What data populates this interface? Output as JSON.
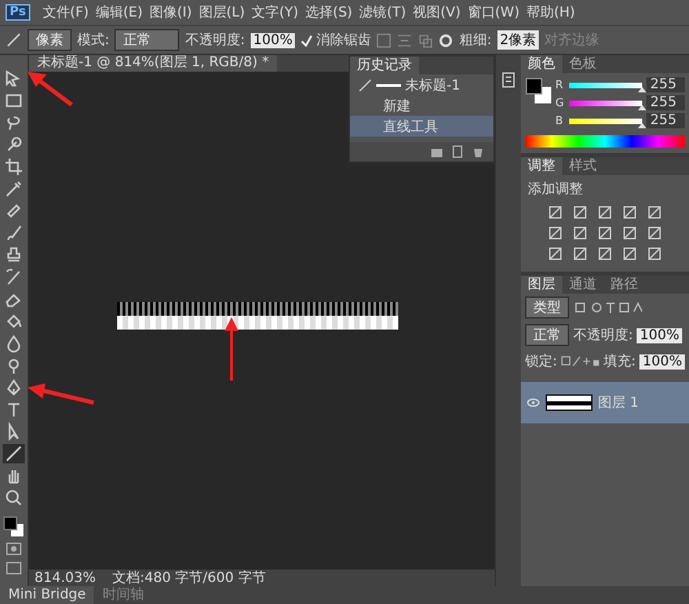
{
  "app": {
    "logo": "Ps"
  },
  "menus": [
    "文件(F)",
    "编辑(E)",
    "图像(I)",
    "图层(L)",
    "文字(Y)",
    "选择(S)",
    "滤镜(T)",
    "视图(V)",
    "窗口(W)",
    "帮助(H)"
  ],
  "options": {
    "preset": "像素",
    "mode_label": "模式:",
    "mode": "正常",
    "opacity_label": "不透明度:",
    "opacity": "100%",
    "anti_alias": {
      "label": "消除锯齿",
      "checked": true
    },
    "weight_label": "粗细:",
    "weight": "2像素",
    "align": {
      "label": "对齐边缘",
      "disabled": true
    }
  },
  "document": {
    "tab": "未标题-1 @ 814%(图层 1, RGB/8) *",
    "zoom": "814.03%",
    "info": "文档:480 字节/600 字节"
  },
  "tools": [
    {
      "kind": "move",
      "selected": false
    },
    {
      "kind": "marquee",
      "selected": false
    },
    {
      "kind": "lasso",
      "selected": false
    },
    {
      "kind": "quickselect",
      "selected": false
    },
    {
      "kind": "crop",
      "selected": false
    },
    {
      "kind": "eyedropper",
      "selected": false
    },
    {
      "kind": "healing",
      "selected": false
    },
    {
      "kind": "brush",
      "selected": false
    },
    {
      "kind": "stamp",
      "selected": false
    },
    {
      "kind": "historybrush",
      "selected": false
    },
    {
      "kind": "eraser",
      "selected": false
    },
    {
      "kind": "bucket",
      "selected": false
    },
    {
      "kind": "blur",
      "selected": false
    },
    {
      "kind": "dodge",
      "selected": false
    },
    {
      "kind": "pen",
      "selected": false
    },
    {
      "kind": "type",
      "selected": false
    },
    {
      "kind": "pathselect",
      "selected": false
    },
    {
      "kind": "line",
      "selected": true
    },
    {
      "kind": "hand",
      "selected": false
    },
    {
      "kind": "zoom",
      "selected": false
    }
  ],
  "history": {
    "title": "历史记录",
    "snapshot": "未标题-1",
    "items": [
      {
        "label": "新建",
        "selected": false
      },
      {
        "label": "直线工具",
        "selected": true
      }
    ]
  },
  "color": {
    "tabs": [
      {
        "label": "颜色",
        "selected": true
      },
      {
        "label": "色板",
        "selected": false
      }
    ],
    "channels": [
      {
        "label": "R",
        "value": "255",
        "level": 1
      },
      {
        "label": "G",
        "value": "255",
        "level": 1
      },
      {
        "label": "B",
        "value": "255",
        "level": 1
      }
    ]
  },
  "adjustments": {
    "tabs": [
      {
        "label": "调整",
        "selected": true
      },
      {
        "label": "样式",
        "selected": false
      }
    ],
    "heading": "添加调整"
  },
  "layers": {
    "tabs": [
      {
        "label": "图层",
        "selected": true
      },
      {
        "label": "通道",
        "selected": false
      },
      {
        "label": "路径",
        "selected": false
      }
    ],
    "filter": "类型",
    "blend": "正常",
    "opacity_label": "不透明度:",
    "opacity": "100%",
    "lock_label": "锁定:",
    "fill_label": "填充:",
    "fill": "100%",
    "items": [
      {
        "name": "图层 1",
        "visible": true,
        "selected": true
      }
    ]
  },
  "bottom_tabs": [
    {
      "label": "Mini Bridge",
      "selected": true
    },
    {
      "label": "时间轴",
      "selected": false
    }
  ]
}
